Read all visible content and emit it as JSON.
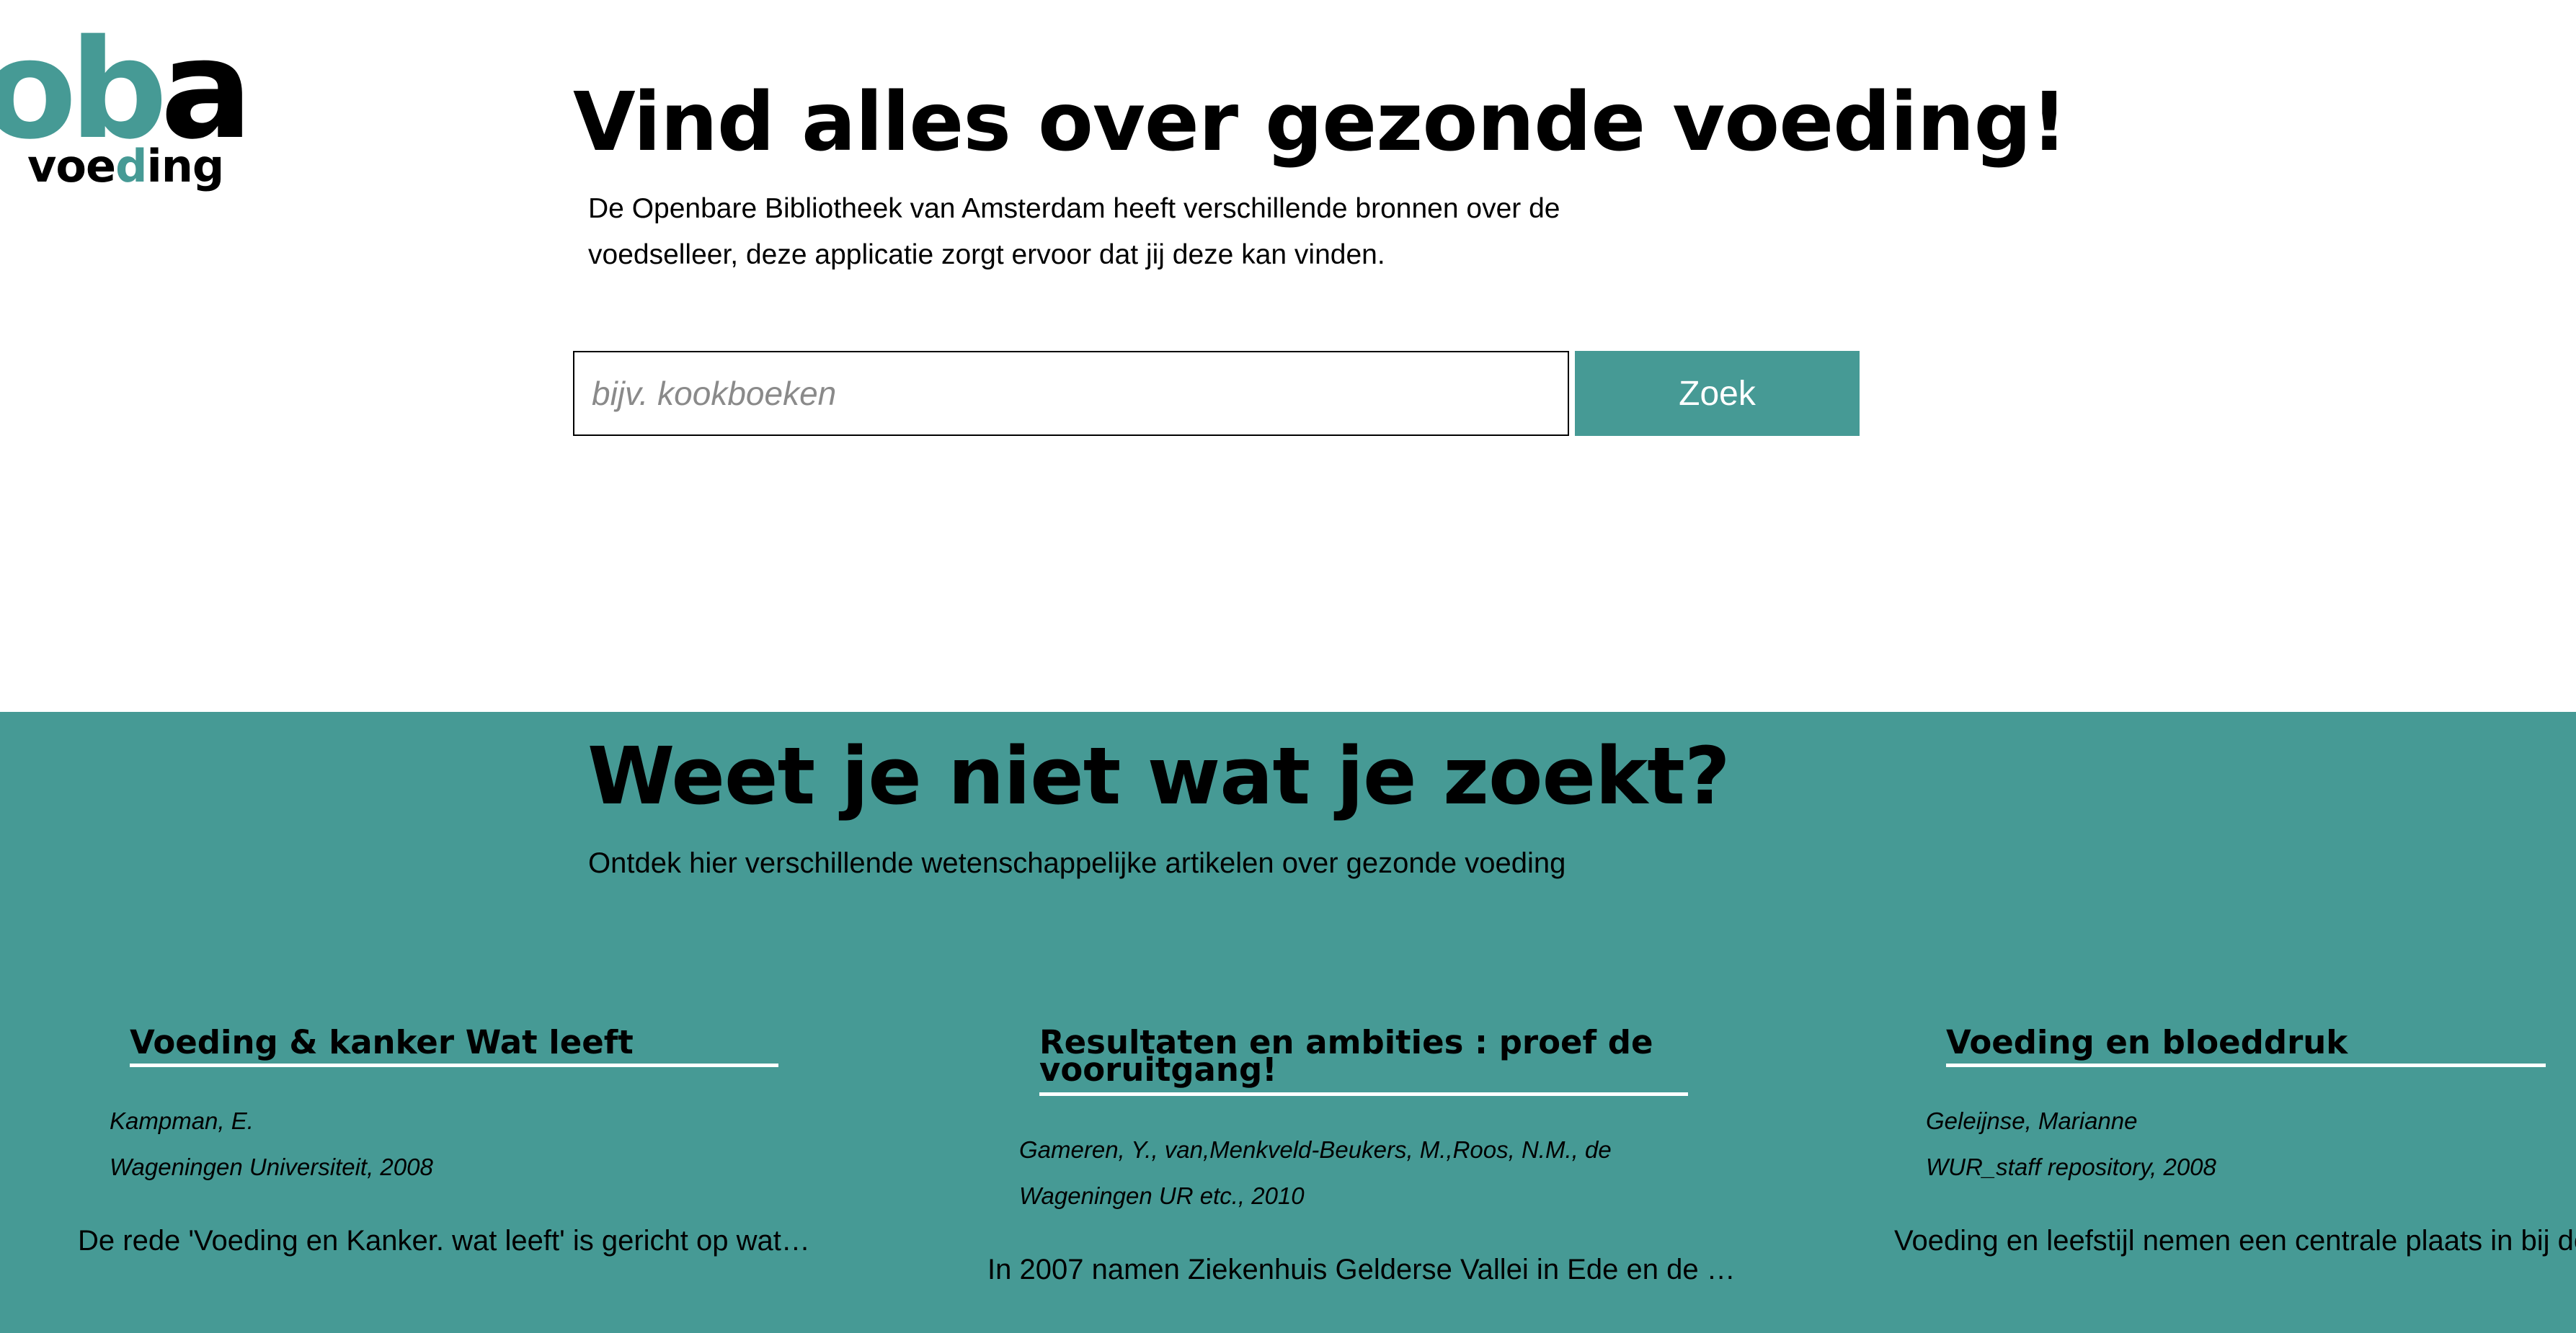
{
  "logo": {
    "part1": "ob",
    "part2": "a",
    "sub1": "voe",
    "sub2": "d",
    "sub3": "ing"
  },
  "hero": {
    "title": "Vind alles over gezonde voeding!",
    "description": "De Openbare Bibliotheek van Amsterdam heeft verschillende bronnen over de voedselleer, deze applicatie zorgt ervoor dat jij deze kan vinden."
  },
  "search": {
    "placeholder": "bijv. kookboeken",
    "value": "",
    "button_label": "Zoek"
  },
  "discover": {
    "title": "Weet je niet wat je zoekt?",
    "subtitle": "Ontdek hier verschillende wetenschappelijke artikelen over gezonde voeding",
    "articles": [
      {
        "title": "Voeding & kanker Wat leeft",
        "author": "Kampman, E.",
        "publisher": "Wageningen Universiteit, 2008",
        "summary": "De rede 'Voeding en Kanker. wat leeft' is gericht op wat…"
      },
      {
        "title": "Resultaten en ambities : proef de vooruitgang!",
        "author": "Gameren, Y., van,Menkveld-Beukers, M.,Roos, N.M., de",
        "publisher": "Wageningen UR etc., 2010",
        "summary": "In 2007 namen Ziekenhuis Gelderse Vallei in Ede en de …"
      },
      {
        "title": "Voeding en bloeddruk",
        "author": "Geleijnse, Marianne",
        "publisher": "WUR_staff repository, 2008",
        "summary": "Voeding en leefstijl nemen een centrale plaats in bij de"
      }
    ]
  },
  "colors": {
    "brand_teal": "#469a95",
    "text": "#000000",
    "background": "#ffffff"
  }
}
